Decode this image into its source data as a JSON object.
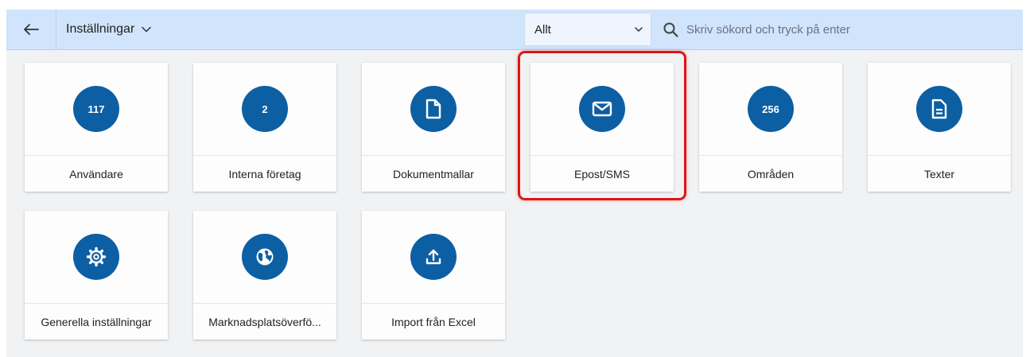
{
  "header": {
    "back_icon": "arrow-left-icon",
    "section_title": "Inställningar",
    "section_chevron_icon": "chevron-down-icon",
    "filter_value": "Allt",
    "filter_caret_icon": "chevron-down-icon",
    "search_icon": "search-icon",
    "search_placeholder": "Skriv sökord och tryck på enter",
    "search_value": ""
  },
  "tiles": [
    {
      "label": "Användare",
      "badge": "117",
      "icon": "count-badge"
    },
    {
      "label": "Interna företag",
      "badge": "2",
      "icon": "count-badge"
    },
    {
      "label": "Dokumentmallar",
      "badge": "",
      "icon": "document-icon"
    },
    {
      "label": "Epost/SMS",
      "badge": "",
      "icon": "mail-icon",
      "highlighted": true
    },
    {
      "label": "Områden",
      "badge": "256",
      "icon": "count-badge"
    },
    {
      "label": "Texter",
      "badge": "",
      "icon": "text-document-icon"
    },
    {
      "label": "Generella inställningar",
      "badge": "",
      "icon": "gear-icon"
    },
    {
      "label": "Marknadsplatsöverfö...",
      "badge": "",
      "icon": "globe-icon"
    },
    {
      "label": "Import från Excel",
      "badge": "",
      "icon": "upload-icon"
    }
  ],
  "colors": {
    "topbar": "#d0e4fb",
    "background": "#f1f2f4",
    "icon_circle": "#0d5fa3",
    "highlight": "#e01414"
  }
}
